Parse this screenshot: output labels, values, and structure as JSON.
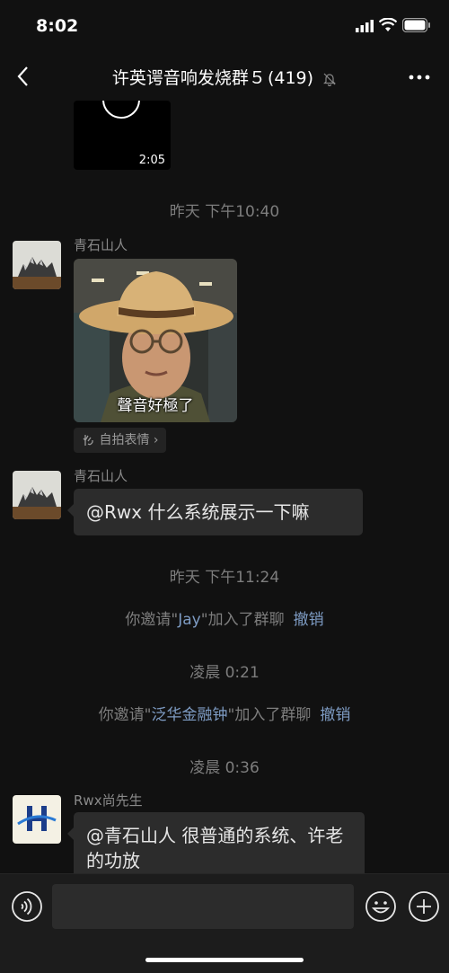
{
  "status_bar": {
    "time": "8:02"
  },
  "header": {
    "title": "许英谔音响发烧群５",
    "member_count": "(419)",
    "back_icon": "chevron-left-icon",
    "mute_icon": "bell-off-icon",
    "more_icon": "more-dots-icon"
  },
  "messages": {
    "video": {
      "duration": "2:05"
    },
    "ts1": "昨天 下午10:40",
    "msg1": {
      "sender": "青石山人",
      "sticker_caption": "聲音好極了",
      "sticker_link": "自拍表情",
      "sticker_link_arrow": "›"
    },
    "msg2": {
      "sender": "青石山人",
      "text": "@Rwx 什么系统展示一下嘛"
    },
    "ts2": "昨天 下午11:24",
    "sys1": {
      "prefix": "你邀请\"",
      "name": "Jay",
      "suffix": "\"加入了群聊",
      "undo": "撤销"
    },
    "ts3": "凌晨 0:21",
    "sys2": {
      "prefix": "你邀请\"",
      "name": "泛华金融钟",
      "suffix": "\"加入了群聊",
      "undo": "撤销"
    },
    "ts4": "凌晨 0:36",
    "msg3": {
      "sender": "Rwx尚先生",
      "text": "@青石山人 很普通的系统、许老的功放"
    }
  },
  "input_bar": {
    "placeholder": ""
  },
  "colors": {
    "background": "#111111",
    "bubble": "#2c2c2c",
    "link": "#7e9cc4"
  }
}
